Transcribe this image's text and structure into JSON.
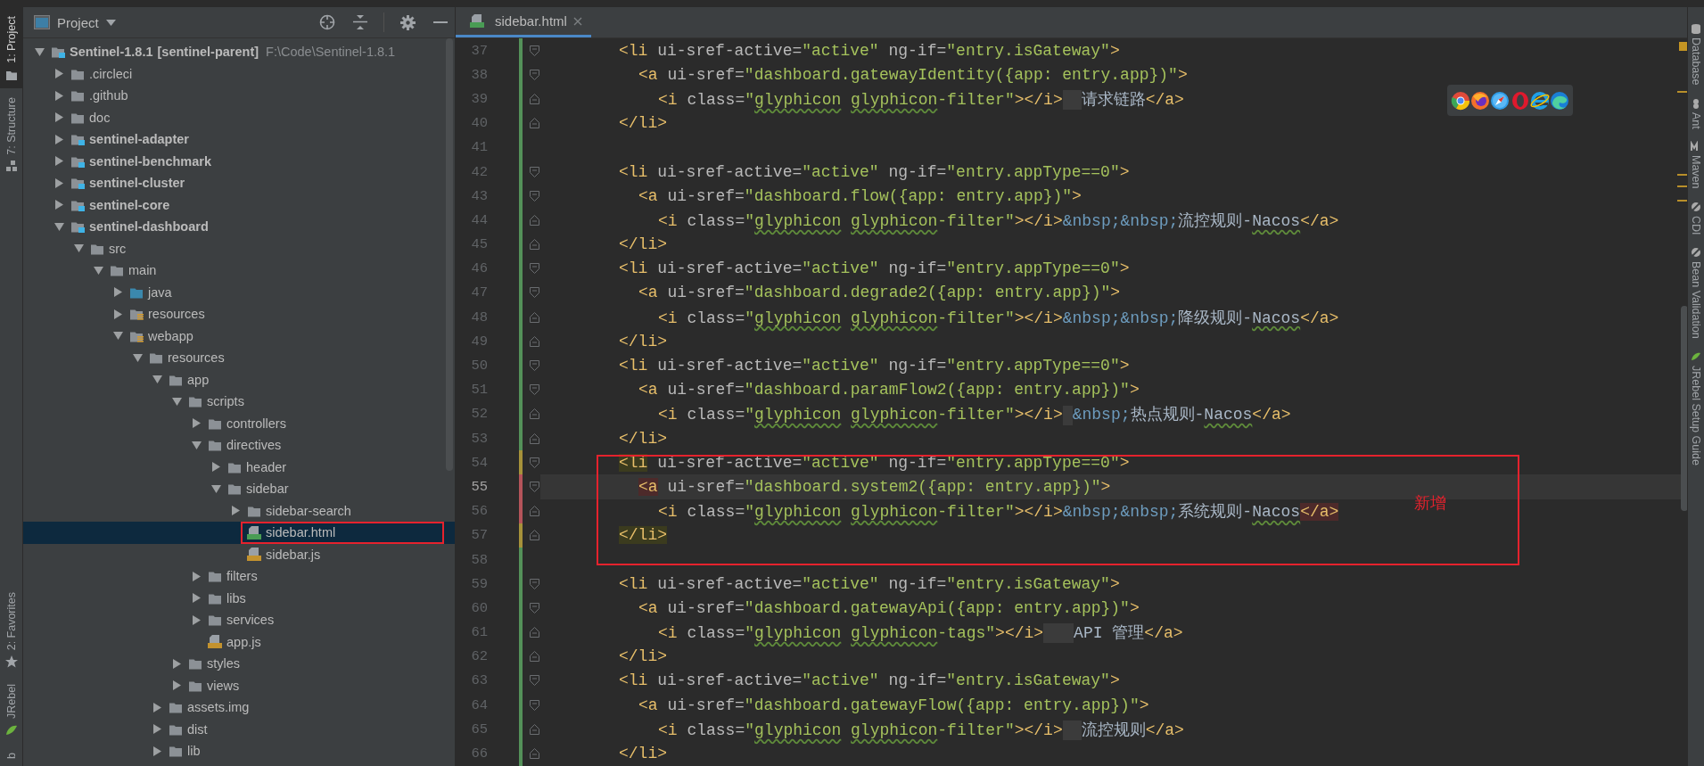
{
  "left_toolbar": {
    "top": [
      {
        "label": "1: Project",
        "selected": true
      },
      {
        "label": "7: Structure",
        "selected": false
      }
    ],
    "bottom": [
      {
        "label": "2: Favorites",
        "selected": false
      },
      {
        "label": "JRebel",
        "selected": false
      },
      {
        "label": "b",
        "selected": false
      }
    ]
  },
  "project": {
    "title": "Project",
    "tree": [
      {
        "name": "Sentinel-1.8.1",
        "tag": "[sentinel-parent]",
        "path": "F:\\Code\\Sentinel-1.8.1",
        "kind": "module",
        "expanded": true,
        "selected": false,
        "boxed": false,
        "children": [
          {
            "name": ".circleci",
            "kind": "folder",
            "expanded": false,
            "selected": false,
            "boxed": false
          },
          {
            "name": ".github",
            "kind": "folder",
            "expanded": false,
            "selected": false,
            "boxed": false
          },
          {
            "name": "doc",
            "kind": "folder",
            "expanded": false,
            "selected": false,
            "boxed": false
          },
          {
            "name": "sentinel-adapter",
            "kind": "module",
            "expanded": false,
            "selected": false,
            "boxed": false
          },
          {
            "name": "sentinel-benchmark",
            "kind": "module",
            "expanded": false,
            "selected": false,
            "boxed": false
          },
          {
            "name": "sentinel-cluster",
            "kind": "module",
            "expanded": false,
            "selected": false,
            "boxed": false
          },
          {
            "name": "sentinel-core",
            "kind": "module",
            "expanded": false,
            "selected": false,
            "boxed": false
          },
          {
            "name": "sentinel-dashboard",
            "kind": "module",
            "expanded": true,
            "selected": false,
            "boxed": false,
            "children": [
              {
                "name": "src",
                "kind": "folder",
                "expanded": true,
                "selected": false,
                "boxed": false,
                "children": [
                  {
                    "name": "main",
                    "kind": "folder",
                    "expanded": true,
                    "selected": false,
                    "boxed": false,
                    "children": [
                      {
                        "name": "java",
                        "kind": "source",
                        "expanded": false,
                        "selected": false,
                        "boxed": false
                      },
                      {
                        "name": "resources",
                        "kind": "resources",
                        "expanded": false,
                        "selected": false,
                        "boxed": false
                      },
                      {
                        "name": "webapp",
                        "kind": "resources",
                        "expanded": true,
                        "selected": false,
                        "boxed": false,
                        "children": [
                          {
                            "name": "resources",
                            "kind": "folder",
                            "expanded": true,
                            "selected": false,
                            "boxed": false,
                            "children": [
                              {
                                "name": "app",
                                "kind": "folder",
                                "expanded": true,
                                "selected": false,
                                "boxed": false,
                                "children": [
                                  {
                                    "name": "scripts",
                                    "kind": "folder",
                                    "expanded": true,
                                    "selected": false,
                                    "boxed": false,
                                    "children": [
                                      {
                                        "name": "controllers",
                                        "kind": "folder",
                                        "expanded": false,
                                        "selected": false,
                                        "boxed": false
                                      },
                                      {
                                        "name": "directives",
                                        "kind": "folder",
                                        "expanded": true,
                                        "selected": false,
                                        "boxed": false,
                                        "children": [
                                          {
                                            "name": "header",
                                            "kind": "folder",
                                            "expanded": false,
                                            "selected": false,
                                            "boxed": false
                                          },
                                          {
                                            "name": "sidebar",
                                            "kind": "folder",
                                            "expanded": true,
                                            "selected": false,
                                            "boxed": false,
                                            "children": [
                                              {
                                                "name": "sidebar-search",
                                                "kind": "folder",
                                                "expanded": false,
                                                "selected": false,
                                                "boxed": false
                                              },
                                              {
                                                "name": "sidebar.html",
                                                "kind": "html",
                                                "selected": true,
                                                "boxed": true
                                              },
                                              {
                                                "name": "sidebar.js",
                                                "kind": "js",
                                                "selected": false,
                                                "boxed": false
                                              }
                                            ]
                                          }
                                        ]
                                      },
                                      {
                                        "name": "filters",
                                        "kind": "folder",
                                        "expanded": false,
                                        "selected": false,
                                        "boxed": false
                                      },
                                      {
                                        "name": "libs",
                                        "kind": "folder",
                                        "expanded": false,
                                        "selected": false,
                                        "boxed": false
                                      },
                                      {
                                        "name": "services",
                                        "kind": "folder",
                                        "expanded": false,
                                        "selected": false,
                                        "boxed": false
                                      },
                                      {
                                        "name": "app.js",
                                        "kind": "js",
                                        "selected": false,
                                        "boxed": false
                                      }
                                    ]
                                  },
                                  {
                                    "name": "styles",
                                    "kind": "folder",
                                    "expanded": false,
                                    "selected": false,
                                    "boxed": false
                                  },
                                  {
                                    "name": "views",
                                    "kind": "folder",
                                    "expanded": false,
                                    "selected": false,
                                    "boxed": false
                                  }
                                ]
                              },
                              {
                                "name": "assets.img",
                                "kind": "folder",
                                "expanded": false,
                                "selected": false,
                                "boxed": false
                              },
                              {
                                "name": "dist",
                                "kind": "folder",
                                "expanded": false,
                                "selected": false,
                                "boxed": false
                              },
                              {
                                "name": "lib",
                                "kind": "folder",
                                "expanded": false,
                                "selected": false,
                                "boxed": false
                              }
                            ]
                          }
                        ]
                      }
                    ]
                  }
                ]
              }
            ]
          }
        ]
      }
    ]
  },
  "editor": {
    "tabs": [
      {
        "label": "sidebar.html",
        "selected": true
      }
    ],
    "annotation_label": "新增",
    "lines": [
      {
        "number": "37",
        "modified": false,
        "conflict": false,
        "fold_open": true,
        "fold_close": false,
        "current": false,
        "boxed": false,
        "kind": "outer",
        "tokens": [
          {
            "kind": "tag",
            "text": "<li"
          },
          {
            "kind": "attr",
            "text": " ui-sref-active="
          },
          {
            "kind": "str",
            "text": "\"active\""
          },
          {
            "kind": "attr",
            "text": " ng-if="
          },
          {
            "kind": "str",
            "text": "\"entry.isGateway\""
          },
          {
            "kind": "tag",
            "text": ">"
          }
        ]
      },
      {
        "number": "38",
        "modified": false,
        "conflict": false,
        "fold_open": true,
        "fold_close": false,
        "current": false,
        "boxed": false,
        "kind": "middle",
        "tokens": [
          {
            "kind": "tag",
            "text": "<a"
          },
          {
            "kind": "attr",
            "text": " ui-sref="
          },
          {
            "kind": "str",
            "text": "\"dashboard.gatewayIdentity({app: entry.app})\""
          },
          {
            "kind": "tag",
            "text": ">"
          }
        ]
      },
      {
        "number": "39",
        "modified": false,
        "conflict": false,
        "fold_open": false,
        "fold_close": true,
        "current": false,
        "boxed": false,
        "kind": "inner",
        "tokens": [
          {
            "kind": "tag",
            "text": "<i"
          },
          {
            "kind": "attr",
            "text": " class="
          },
          {
            "kind": "str",
            "text": "\""
          },
          {
            "kind": "str-typo",
            "text": "glyphicon"
          },
          {
            "kind": "space"
          },
          {
            "kind": "str-typo",
            "text": "glyphicon"
          },
          {
            "kind": "str",
            "text": "-filter\""
          },
          {
            "kind": "tag",
            "text": "></i>"
          },
          {
            "kind": "space-mark"
          },
          {
            "kind": "text",
            "text": "请求链路"
          },
          {
            "kind": "tag",
            "text": "</a>"
          }
        ]
      },
      {
        "number": "40",
        "modified": false,
        "conflict": false,
        "fold_open": false,
        "fold_close": true,
        "current": false,
        "boxed": false,
        "kind": "outer",
        "tokens": [
          {
            "kind": "tag",
            "text": "</li>"
          }
        ]
      },
      {
        "number": "41",
        "modified": false,
        "conflict": false,
        "current": false,
        "boxed": false,
        "kind": "blank"
      },
      {
        "number": "42",
        "modified": false,
        "conflict": false,
        "fold_open": true,
        "fold_close": false,
        "current": false,
        "boxed": false,
        "kind": "outer",
        "tokens": [
          {
            "kind": "tag",
            "text": "<li"
          },
          {
            "kind": "attr",
            "text": " ui-sref-active="
          },
          {
            "kind": "str",
            "text": "\"active\""
          },
          {
            "kind": "attr",
            "text": " ng-if="
          },
          {
            "kind": "str",
            "text": "\"entry.appType==0\""
          },
          {
            "kind": "tag",
            "text": ">"
          }
        ]
      },
      {
        "number": "43",
        "modified": false,
        "conflict": false,
        "fold_open": true,
        "fold_close": false,
        "current": false,
        "boxed": false,
        "kind": "middle",
        "tokens": [
          {
            "kind": "tag",
            "text": "<a"
          },
          {
            "kind": "attr",
            "text": " ui-sref="
          },
          {
            "kind": "str",
            "text": "\"dashboard.flow({app: entry.app})\""
          },
          {
            "kind": "tag",
            "text": ">"
          }
        ]
      },
      {
        "number": "44",
        "modified": false,
        "conflict": false,
        "fold_open": false,
        "fold_close": true,
        "current": false,
        "boxed": false,
        "kind": "inner",
        "tokens": [
          {
            "kind": "tag",
            "text": "<i"
          },
          {
            "kind": "attr",
            "text": " class="
          },
          {
            "kind": "str",
            "text": "\""
          },
          {
            "kind": "str-typo",
            "text": "glyphicon"
          },
          {
            "kind": "space"
          },
          {
            "kind": "str-typo",
            "text": "glyphicon"
          },
          {
            "kind": "str",
            "text": "-filter\""
          },
          {
            "kind": "tag",
            "text": "></i>"
          },
          {
            "kind": "entity",
            "text": "&nbsp;&nbsp;"
          },
          {
            "kind": "text",
            "text": "流控规则-"
          },
          {
            "kind": "text-typo",
            "text": "Nacos"
          },
          {
            "kind": "tag",
            "text": "</a>"
          }
        ]
      },
      {
        "number": "45",
        "modified": false,
        "conflict": false,
        "fold_open": false,
        "fold_close": true,
        "current": false,
        "boxed": false,
        "kind": "outer",
        "tokens": [
          {
            "kind": "tag",
            "text": "</li>"
          }
        ]
      },
      {
        "number": "46",
        "modified": false,
        "conflict": false,
        "fold_open": true,
        "fold_close": false,
        "current": false,
        "boxed": false,
        "kind": "outer",
        "tokens": [
          {
            "kind": "tag",
            "text": "<li"
          },
          {
            "kind": "attr",
            "text": " ui-sref-active="
          },
          {
            "kind": "str",
            "text": "\"active\""
          },
          {
            "kind": "attr",
            "text": " ng-if="
          },
          {
            "kind": "str",
            "text": "\"entry.appType==0\""
          },
          {
            "kind": "tag",
            "text": ">"
          }
        ]
      },
      {
        "number": "47",
        "modified": false,
        "conflict": false,
        "fold_open": true,
        "fold_close": false,
        "current": false,
        "boxed": false,
        "kind": "middle",
        "tokens": [
          {
            "kind": "tag",
            "text": "<a"
          },
          {
            "kind": "attr",
            "text": " ui-sref="
          },
          {
            "kind": "str",
            "text": "\"dashboard.degrade2({app: entry.app})\""
          },
          {
            "kind": "tag",
            "text": ">"
          }
        ]
      },
      {
        "number": "48",
        "modified": false,
        "conflict": false,
        "fold_open": false,
        "fold_close": true,
        "current": false,
        "boxed": false,
        "kind": "inner",
        "tokens": [
          {
            "kind": "tag",
            "text": "<i"
          },
          {
            "kind": "attr",
            "text": " class="
          },
          {
            "kind": "str",
            "text": "\""
          },
          {
            "kind": "str-typo",
            "text": "glyphicon"
          },
          {
            "kind": "space"
          },
          {
            "kind": "str-typo",
            "text": "glyphicon"
          },
          {
            "kind": "str",
            "text": "-filter\""
          },
          {
            "kind": "tag",
            "text": "></i>"
          },
          {
            "kind": "entity",
            "text": "&nbsp;&nbsp;"
          },
          {
            "kind": "text",
            "text": "降级规则-"
          },
          {
            "kind": "text-typo",
            "text": "Nacos"
          },
          {
            "kind": "tag",
            "text": "</a>"
          }
        ]
      },
      {
        "number": "49",
        "modified": false,
        "conflict": false,
        "fold_open": false,
        "fold_close": true,
        "current": false,
        "boxed": false,
        "kind": "outer",
        "tokens": [
          {
            "kind": "tag",
            "text": "</li>"
          }
        ]
      },
      {
        "number": "50",
        "modified": false,
        "conflict": false,
        "fold_open": true,
        "fold_close": false,
        "current": false,
        "boxed": false,
        "kind": "outer",
        "tokens": [
          {
            "kind": "tag",
            "text": "<li"
          },
          {
            "kind": "attr",
            "text": " ui-sref-active="
          },
          {
            "kind": "str",
            "text": "\"active\""
          },
          {
            "kind": "attr",
            "text": " ng-if="
          },
          {
            "kind": "str",
            "text": "\"entry.appType==0\""
          },
          {
            "kind": "tag",
            "text": ">"
          }
        ]
      },
      {
        "number": "51",
        "modified": false,
        "conflict": false,
        "fold_open": true,
        "fold_close": false,
        "current": false,
        "boxed": false,
        "kind": "middle",
        "tokens": [
          {
            "kind": "tag",
            "text": "<a"
          },
          {
            "kind": "attr",
            "text": " ui-sref="
          },
          {
            "kind": "str",
            "text": "\"dashboard.paramFlow2({app: entry.app})\""
          },
          {
            "kind": "tag",
            "text": ">"
          }
        ]
      },
      {
        "number": "52",
        "modified": false,
        "conflict": false,
        "fold_open": false,
        "fold_close": true,
        "current": false,
        "boxed": false,
        "kind": "inner",
        "tokens": [
          {
            "kind": "tag",
            "text": "<i"
          },
          {
            "kind": "attr",
            "text": " class="
          },
          {
            "kind": "str",
            "text": "\""
          },
          {
            "kind": "str-typo",
            "text": "glyphicon"
          },
          {
            "kind": "space"
          },
          {
            "kind": "str-typo",
            "text": "glyphicon"
          },
          {
            "kind": "str",
            "text": "-filter\""
          },
          {
            "kind": "tag",
            "text": "></i>"
          },
          {
            "kind": "space-mark-narrow"
          },
          {
            "kind": "entity",
            "text": "&nbsp;"
          },
          {
            "kind": "text",
            "text": "热点规则-"
          },
          {
            "kind": "text-typo",
            "text": "Nacos"
          },
          {
            "kind": "tag",
            "text": "</a>"
          }
        ]
      },
      {
        "number": "53",
        "modified": false,
        "conflict": false,
        "fold_open": false,
        "fold_close": true,
        "current": false,
        "boxed": false,
        "kind": "outer",
        "tokens": [
          {
            "kind": "tag",
            "text": "</li>"
          }
        ]
      },
      {
        "number": "54",
        "modified": true,
        "conflict": false,
        "fold_open": true,
        "fold_close": false,
        "current": false,
        "boxed": true,
        "kind": "outer",
        "tokens": [
          {
            "kind": "tag-pair",
            "text": "<li"
          },
          {
            "kind": "attr",
            "text": " ui-sref-active="
          },
          {
            "kind": "str",
            "text": "\"active\""
          },
          {
            "kind": "attr",
            "text": " ng-if="
          },
          {
            "kind": "str",
            "text": "\"entry.appType==0\""
          },
          {
            "kind": "tag",
            "text": ">"
          }
        ]
      },
      {
        "number": "55",
        "modified": false,
        "conflict": true,
        "fold_open": true,
        "fold_close": false,
        "current": true,
        "boxed": true,
        "kind": "middle",
        "tokens": [
          {
            "kind": "tag-error",
            "text": "<a"
          },
          {
            "kind": "attr",
            "text": " ui-sref="
          },
          {
            "kind": "str",
            "text": "\"dashboard.system2({app: entry.app})\""
          },
          {
            "kind": "tag",
            "text": ">"
          }
        ]
      },
      {
        "number": "56",
        "modified": false,
        "conflict": true,
        "fold_open": false,
        "fold_close": true,
        "current": false,
        "boxed": true,
        "kind": "inner",
        "tokens": [
          {
            "kind": "tag",
            "text": "<i"
          },
          {
            "kind": "attr",
            "text": " class="
          },
          {
            "kind": "str",
            "text": "\""
          },
          {
            "kind": "str-typo",
            "text": "glyphicon"
          },
          {
            "kind": "space"
          },
          {
            "kind": "str-typo",
            "text": "glyphicon"
          },
          {
            "kind": "str",
            "text": "-filter\""
          },
          {
            "kind": "tag",
            "text": "></i>"
          },
          {
            "kind": "entity",
            "text": "&nbsp;&nbsp;"
          },
          {
            "kind": "text",
            "text": "系统规则-"
          },
          {
            "kind": "text-typo",
            "text": "Nacos"
          },
          {
            "kind": "tag-error",
            "text": "</a>"
          }
        ]
      },
      {
        "number": "57",
        "modified": true,
        "conflict": false,
        "fold_open": false,
        "fold_close": true,
        "current": false,
        "boxed": true,
        "kind": "outer",
        "tokens": [
          {
            "kind": "tag-pair",
            "text": "</li>"
          }
        ]
      },
      {
        "number": "58",
        "modified": false,
        "conflict": false,
        "current": false,
        "boxed": true,
        "kind": "blank"
      },
      {
        "number": "59",
        "modified": false,
        "conflict": false,
        "fold_open": true,
        "fold_close": false,
        "current": false,
        "boxed": false,
        "kind": "outer",
        "tokens": [
          {
            "kind": "tag",
            "text": "<li"
          },
          {
            "kind": "attr",
            "text": " ui-sref-active="
          },
          {
            "kind": "str",
            "text": "\"active\""
          },
          {
            "kind": "attr",
            "text": " ng-if="
          },
          {
            "kind": "str",
            "text": "\"entry.isGateway\""
          },
          {
            "kind": "tag",
            "text": ">"
          }
        ]
      },
      {
        "number": "60",
        "modified": false,
        "conflict": false,
        "fold_open": true,
        "fold_close": false,
        "current": false,
        "boxed": false,
        "kind": "middle",
        "tokens": [
          {
            "kind": "tag",
            "text": "<a"
          },
          {
            "kind": "attr",
            "text": " ui-sref="
          },
          {
            "kind": "str",
            "text": "\"dashboard.gatewayApi({app: entry.app})\""
          },
          {
            "kind": "tag",
            "text": ">"
          }
        ]
      },
      {
        "number": "61",
        "modified": false,
        "conflict": false,
        "fold_open": false,
        "fold_close": true,
        "current": false,
        "boxed": false,
        "kind": "inner",
        "tokens": [
          {
            "kind": "tag",
            "text": "<i"
          },
          {
            "kind": "attr",
            "text": " class="
          },
          {
            "kind": "str",
            "text": "\""
          },
          {
            "kind": "str-typo",
            "text": "glyphicon"
          },
          {
            "kind": "space"
          },
          {
            "kind": "str-typo",
            "text": "glyphicon"
          },
          {
            "kind": "str",
            "text": "-tags\""
          },
          {
            "kind": "tag",
            "text": "></i>"
          },
          {
            "kind": "space-mark-wide"
          },
          {
            "kind": "text",
            "text": "API 管理"
          },
          {
            "kind": "tag",
            "text": "</a>"
          }
        ]
      },
      {
        "number": "62",
        "modified": false,
        "conflict": false,
        "fold_open": false,
        "fold_close": true,
        "current": false,
        "boxed": false,
        "kind": "outer",
        "tokens": [
          {
            "kind": "tag",
            "text": "</li>"
          }
        ]
      },
      {
        "number": "63",
        "modified": false,
        "conflict": false,
        "fold_open": true,
        "fold_close": false,
        "current": false,
        "boxed": false,
        "kind": "outer",
        "tokens": [
          {
            "kind": "tag",
            "text": "<li"
          },
          {
            "kind": "attr",
            "text": " ui-sref-active="
          },
          {
            "kind": "str",
            "text": "\"active\""
          },
          {
            "kind": "attr",
            "text": " ng-if="
          },
          {
            "kind": "str",
            "text": "\"entry.isGateway\""
          },
          {
            "kind": "tag",
            "text": ">"
          }
        ]
      },
      {
        "number": "64",
        "modified": false,
        "conflict": false,
        "fold_open": true,
        "fold_close": false,
        "current": false,
        "boxed": false,
        "kind": "middle",
        "tokens": [
          {
            "kind": "tag",
            "text": "<a"
          },
          {
            "kind": "attr",
            "text": " ui-sref="
          },
          {
            "kind": "str",
            "text": "\"dashboard.gatewayFlow({app: entry.app})\""
          },
          {
            "kind": "tag",
            "text": ">"
          }
        ]
      },
      {
        "number": "65",
        "modified": false,
        "conflict": false,
        "fold_open": false,
        "fold_close": true,
        "current": false,
        "boxed": false,
        "kind": "inner",
        "tokens": [
          {
            "kind": "tag",
            "text": "<i"
          },
          {
            "kind": "attr",
            "text": " class="
          },
          {
            "kind": "str",
            "text": "\""
          },
          {
            "kind": "str-typo",
            "text": "glyphicon"
          },
          {
            "kind": "space"
          },
          {
            "kind": "str-typo",
            "text": "glyphicon"
          },
          {
            "kind": "str",
            "text": "-filter\""
          },
          {
            "kind": "tag",
            "text": "></i>"
          },
          {
            "kind": "space-mark"
          },
          {
            "kind": "text",
            "text": "流控规则"
          },
          {
            "kind": "tag",
            "text": "</a>"
          }
        ]
      },
      {
        "number": "66",
        "modified": false,
        "conflict": false,
        "fold_open": false,
        "fold_close": true,
        "current": false,
        "boxed": false,
        "kind": "outer",
        "tokens": [
          {
            "kind": "tag",
            "text": "</li>"
          }
        ]
      }
    ]
  },
  "right_toolbar": [
    {
      "label": "Database"
    },
    {
      "label": "Ant"
    },
    {
      "label": "Maven"
    },
    {
      "label": "CDI"
    },
    {
      "label": "Bean Validation"
    },
    {
      "label": "JRebel Setup Guide"
    }
  ]
}
